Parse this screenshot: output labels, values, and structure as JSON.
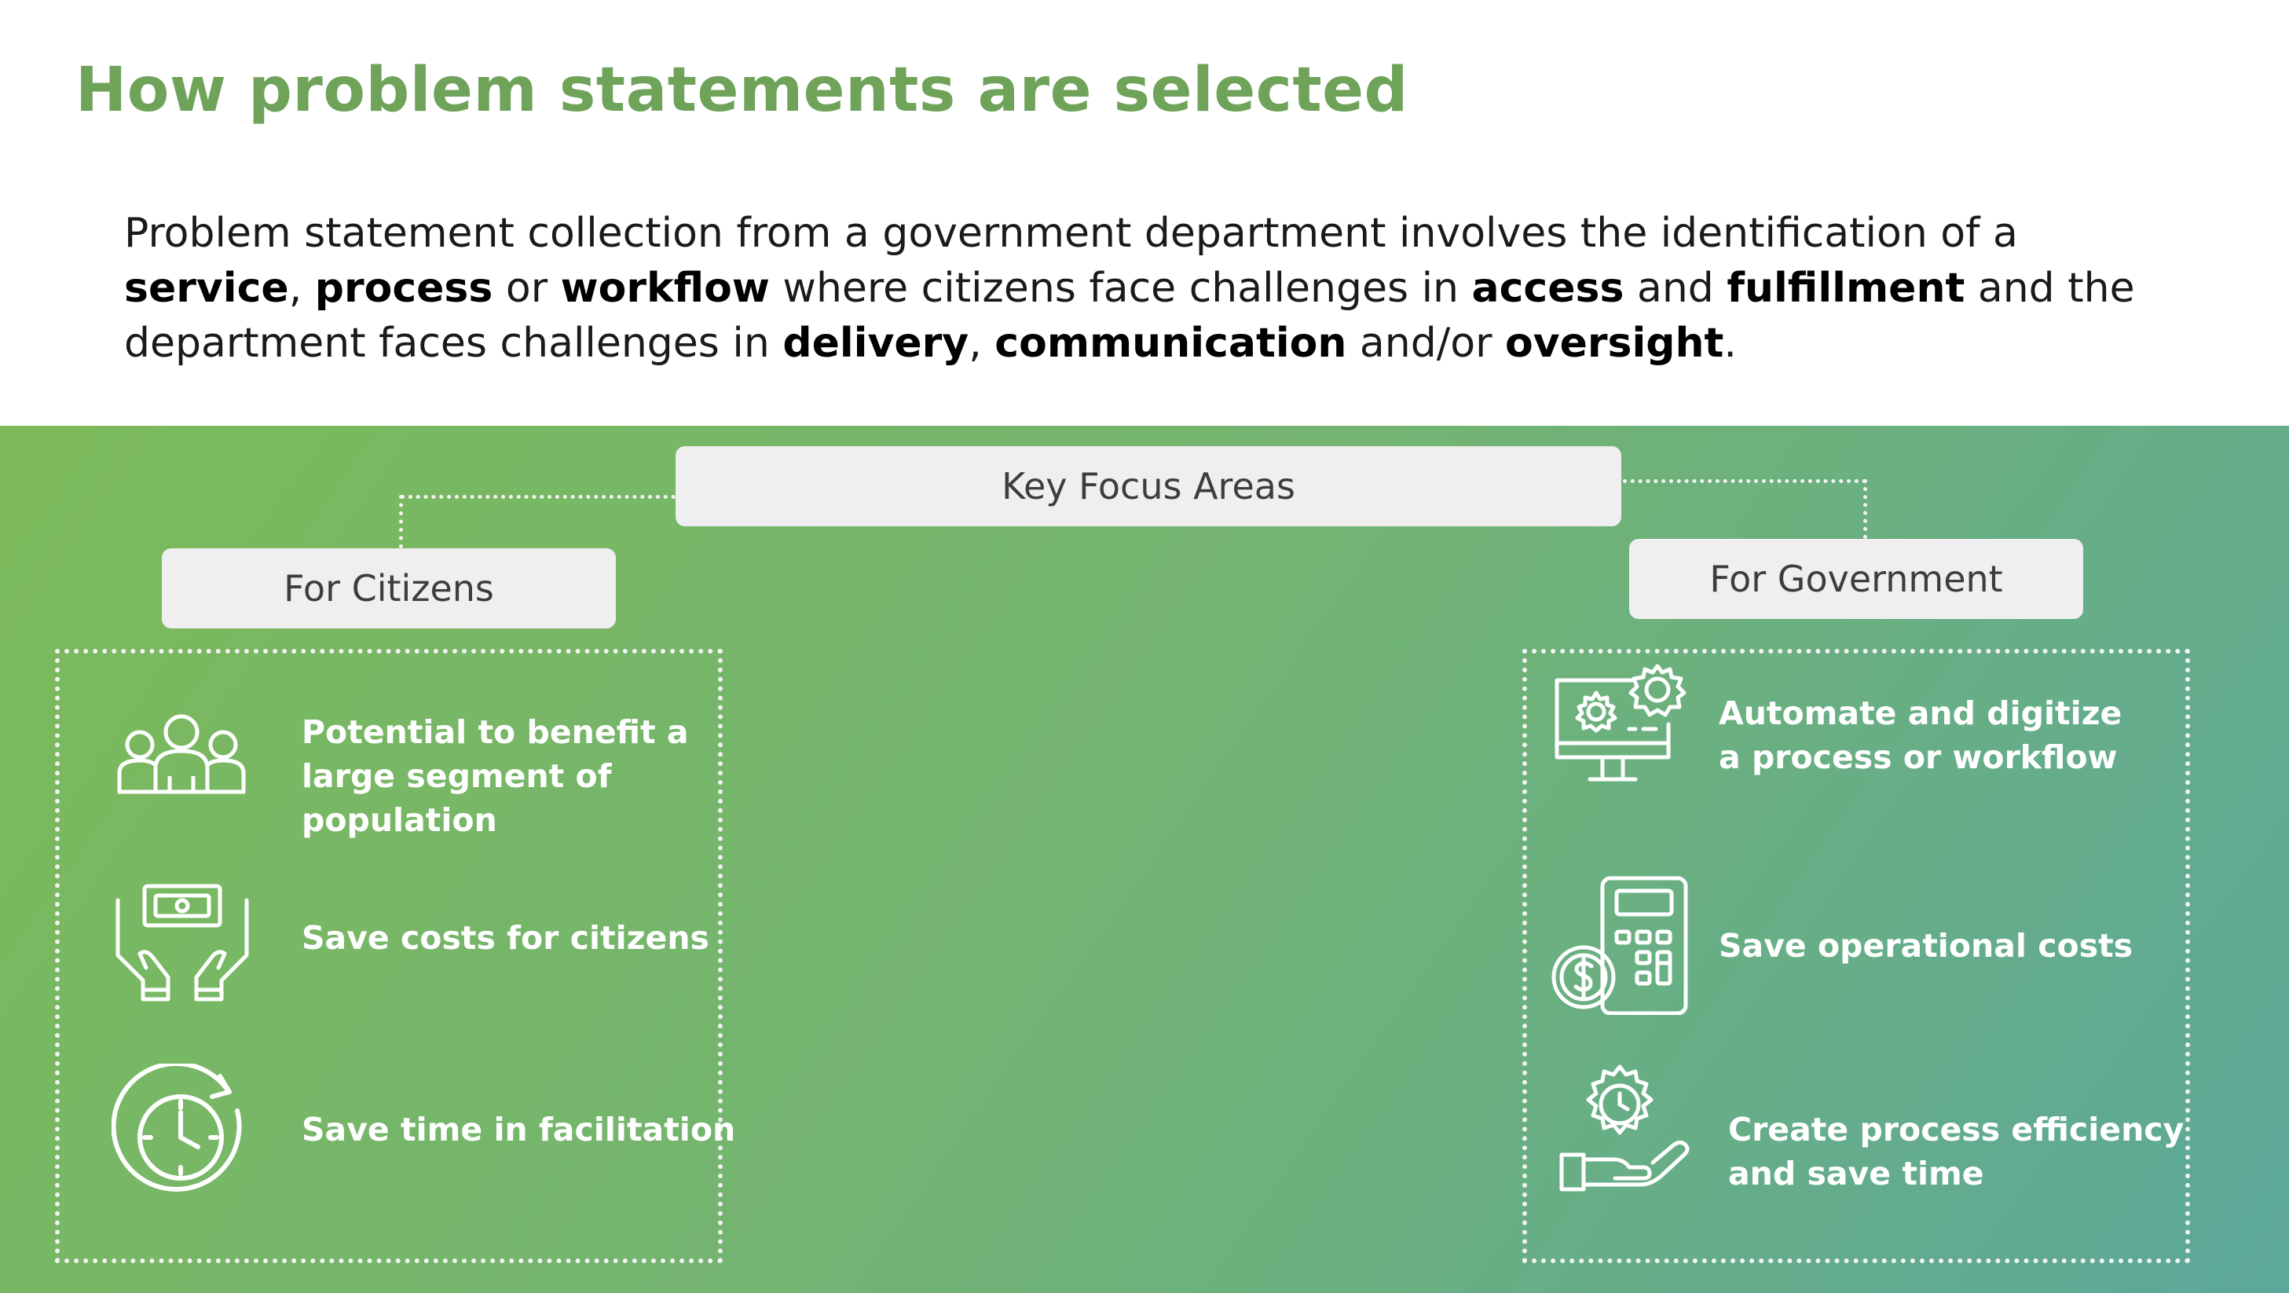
{
  "title": "How problem statements are selected",
  "intro": {
    "p1": "Problem statement collection from a government department involves the identification of a",
    "b1": "service",
    "p2": ", ",
    "b2": "process",
    "p3": " or ",
    "b3": "workflow",
    "p4": " where citizens face challenges in ",
    "b4": "access",
    "p5": " and ",
    "b5": "fulfillment",
    "p6": " and the department faces challenges in ",
    "b6": "delivery",
    "p7": ", ",
    "b7": "communication",
    "p8": " and/or ",
    "b8": "oversight",
    "p9": "."
  },
  "key_focus_label": "Key Focus Areas",
  "citizens": {
    "label": "For Citizens",
    "items": [
      {
        "icon": "people-group-icon",
        "text1": "Potential to benefit a",
        "text2": "large segment of",
        "text3": "population"
      },
      {
        "icon": "hands-money-icon",
        "text1": "Save costs for citizens"
      },
      {
        "icon": "clock-refresh-icon",
        "text1": "Save time in facilitation"
      }
    ]
  },
  "government": {
    "label": "For Government",
    "items": [
      {
        "icon": "monitor-gears-icon",
        "text1": "Automate and digitize",
        "text2": "a process or workflow"
      },
      {
        "icon": "calculator-coin-icon",
        "text1": "Save operational costs"
      },
      {
        "icon": "hand-gear-clock-icon",
        "text1": "Create process efficiency",
        "text2": "and save time"
      }
    ]
  },
  "colors": {
    "title": "#6fa35a",
    "band_start": "#7cba5a",
    "band_end": "#5ca89a",
    "pill": "#efefef"
  }
}
